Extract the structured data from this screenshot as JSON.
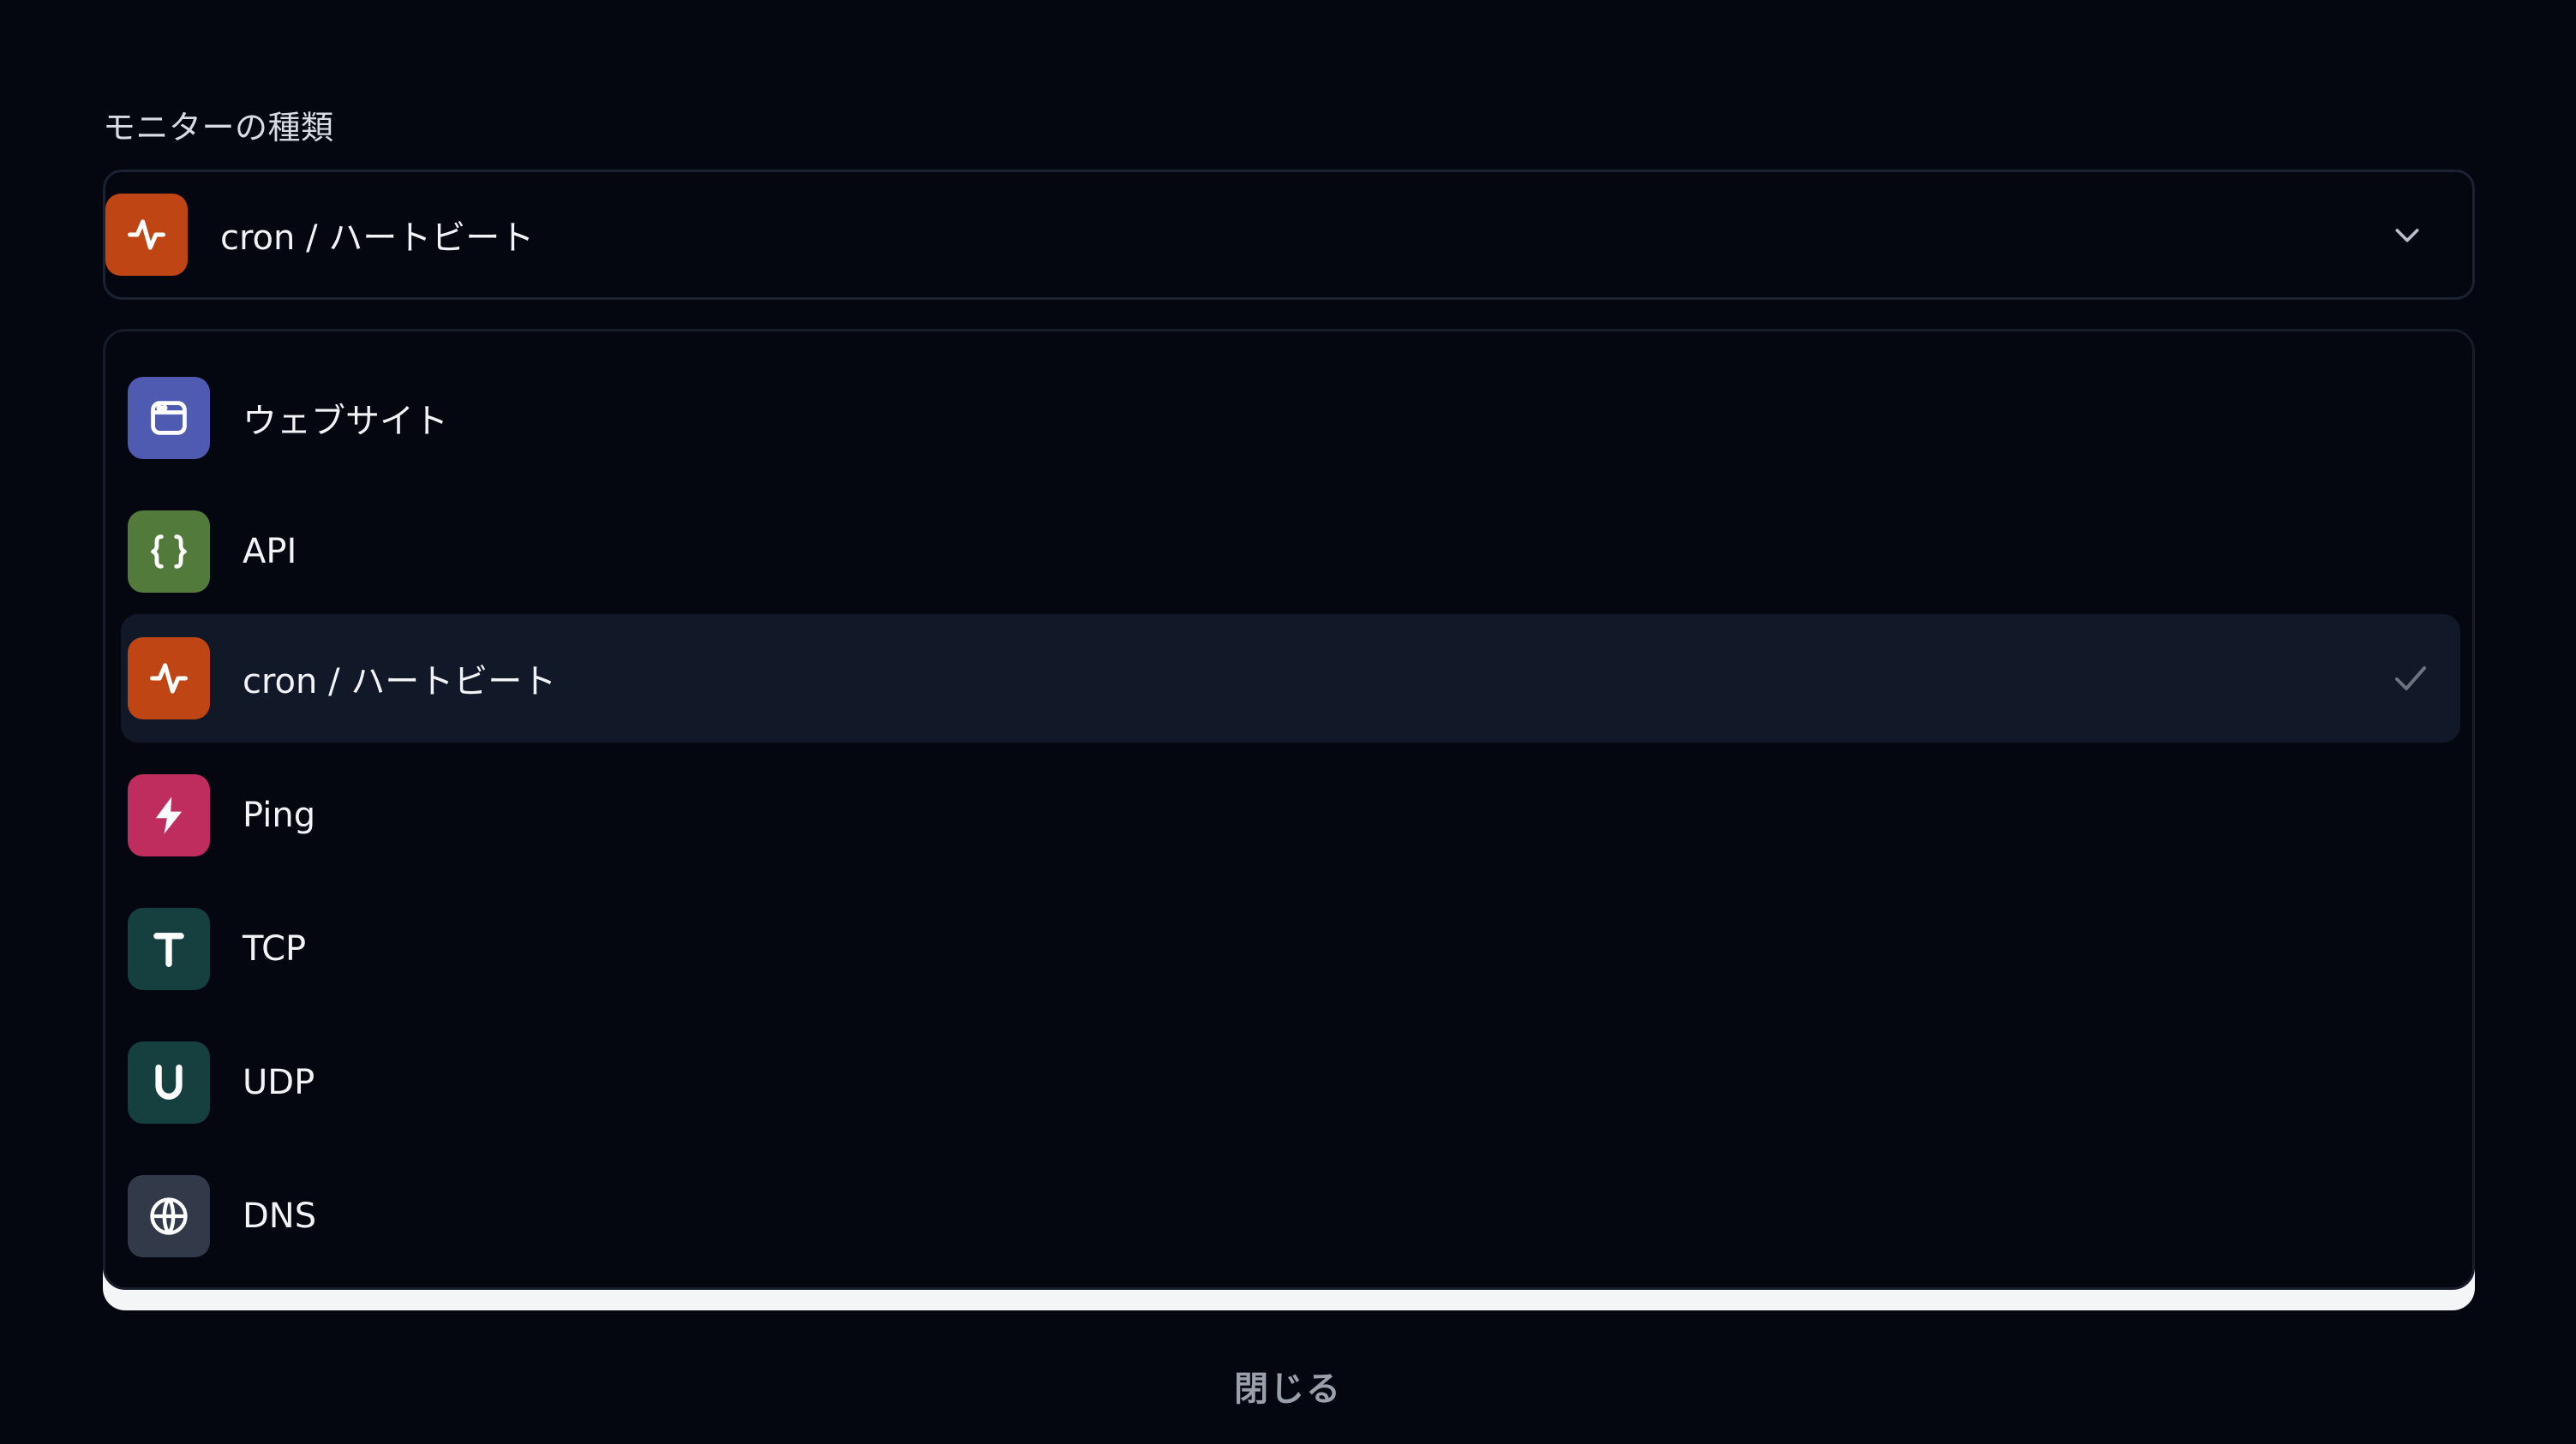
{
  "field": {
    "label": "モニターの種類",
    "selected_value": "cron / ハートビート"
  },
  "options": [
    {
      "label": "ウェブサイト",
      "icon": "browser-window-icon",
      "color": "#4f5bb1"
    },
    {
      "label": "API",
      "icon": "curly-braces-icon",
      "color": "#527a3b"
    },
    {
      "label": "cron / ハートビート",
      "icon": "heartbeat-pulse-icon",
      "color": "#bf4514",
      "selected": true
    },
    {
      "label": "Ping",
      "icon": "lightning-bolt-icon",
      "color": "#bf2c5e"
    },
    {
      "label": "TCP",
      "icon": "letter-t-icon",
      "color": "#15403f"
    },
    {
      "label": "UDP",
      "icon": "letter-u-icon",
      "color": "#15403f"
    },
    {
      "label": "DNS",
      "icon": "globe-icon",
      "color": "#323a4a"
    }
  ],
  "footer": {
    "close_label": "閉じる"
  },
  "colors": {
    "background": "#04070f",
    "selected_row": "#111827",
    "heartbeat_accent": "#bf4514"
  }
}
